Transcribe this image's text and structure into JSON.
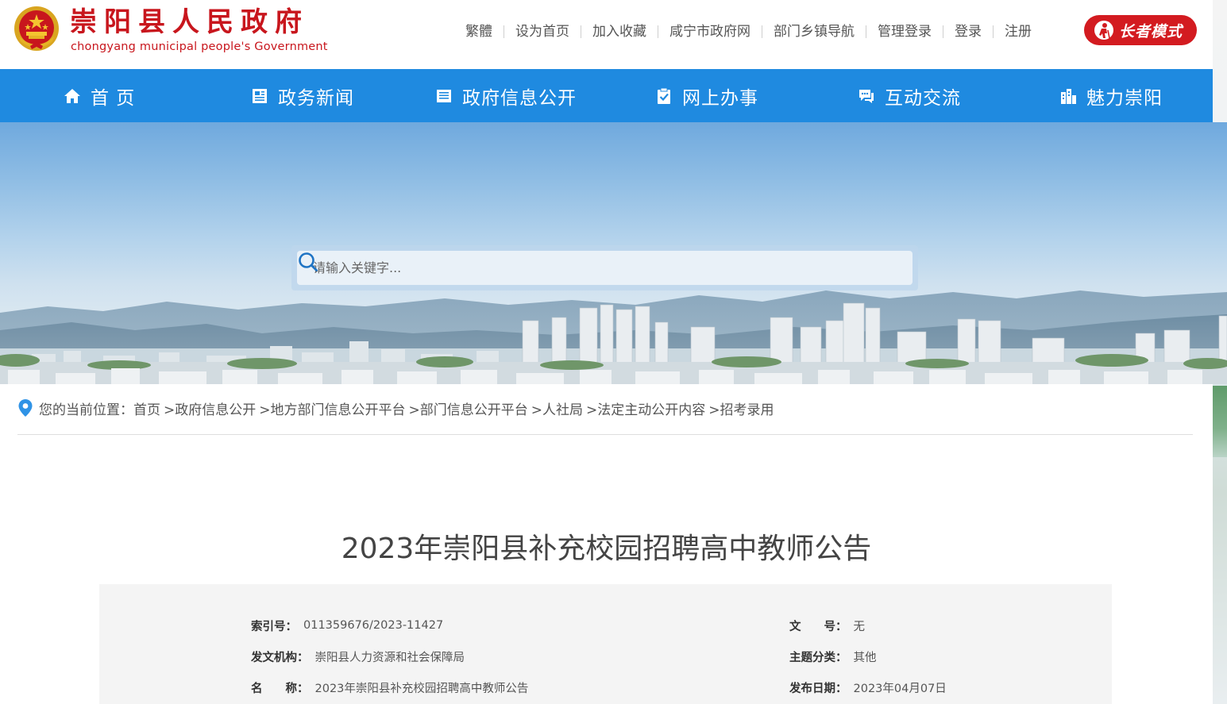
{
  "header": {
    "title": "崇阳县人民政府",
    "subtitle": "chongyang municipal people's Government",
    "links": [
      "繁體",
      "设为首页",
      "加入收藏",
      "咸宁市政府网",
      "部门乡镇导航",
      "管理登录",
      "登录",
      "注册"
    ],
    "elder_mode_label": "长者模式"
  },
  "nav": {
    "items": [
      {
        "label": "首 页",
        "icon": "home-icon"
      },
      {
        "label": "政务新闻",
        "icon": "news-icon"
      },
      {
        "label": "政府信息公开",
        "icon": "document-icon"
      },
      {
        "label": "网上办事",
        "icon": "clipboard-check-icon"
      },
      {
        "label": "互动交流",
        "icon": "chat-icon"
      },
      {
        "label": "魅力崇阳",
        "icon": "city-icon"
      }
    ]
  },
  "search": {
    "placeholder": "请输入关键字..."
  },
  "breadcrumb": {
    "prefix": "您的当前位置：",
    "items": [
      "首页",
      ">政府信息公开",
      ">地方部门信息公开平台",
      ">部门信息公开平台",
      ">人社局",
      ">法定主动公开内容",
      ">招考录用"
    ]
  },
  "article": {
    "title": "2023年崇阳县补充校园招聘高中教师公告"
  },
  "meta": {
    "index_label": "索引号：",
    "index_value": "011359676/2023-11427",
    "doc_no_label": "文　　号：",
    "doc_no_value": "无",
    "issuer_label": "发文机构：",
    "issuer_value": "崇阳县人力资源和社会保障局",
    "topic_label": "主题分类：",
    "topic_value": "其他",
    "name_label": "名　　称：",
    "name_value": "2023年崇阳县补充校园招聘高中教师公告",
    "date_label": "发布日期：",
    "date_value": "2023年04月07日"
  },
  "colors": {
    "brand_red": "#c8161d",
    "nav_blue": "#1f8ae0"
  }
}
